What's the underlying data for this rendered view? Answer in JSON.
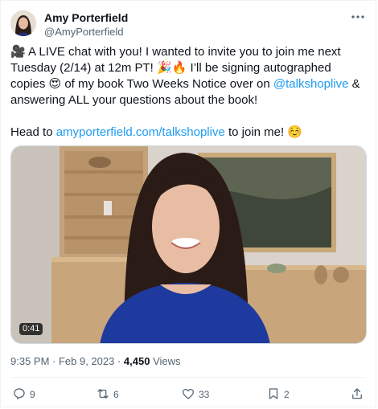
{
  "author": {
    "name": "Amy Porterfield",
    "handle": "@AmyPorterfield"
  },
  "tweet": {
    "emoji_camera": "🎥",
    "p1": " A LIVE chat with you! I wanted to invite you to join me next Tuesday (2/14) at 12m PT! ",
    "emoji_party": "🎉🔥",
    "p2": " I’ll be signing autographed copies ",
    "emoji_love": "😍",
    "p3": " of my book Two Weeks Notice over on ",
    "mention": "@talkshoplive",
    "p4": " & answering ALL your questions about the book!",
    "p5": "Head to ",
    "link": "amyporterfield.com/talkshoplive",
    "p6": " to join me! ",
    "emoji_blush": "☺️"
  },
  "video": {
    "duration": "0:41"
  },
  "meta": {
    "time_date": "9:35 PM · Feb 9, 2023 · ",
    "views_count": "4,450",
    "views_label": " Views"
  },
  "actions": {
    "replies": "9",
    "retweets": "6",
    "likes": "33",
    "bookmarks": "2"
  },
  "icons": [
    "more-icon",
    "reply-icon",
    "retweet-icon",
    "like-icon",
    "bookmark-icon",
    "share-icon"
  ],
  "colors": {
    "link": "#1d9bf0",
    "secondary_text": "#536471"
  }
}
